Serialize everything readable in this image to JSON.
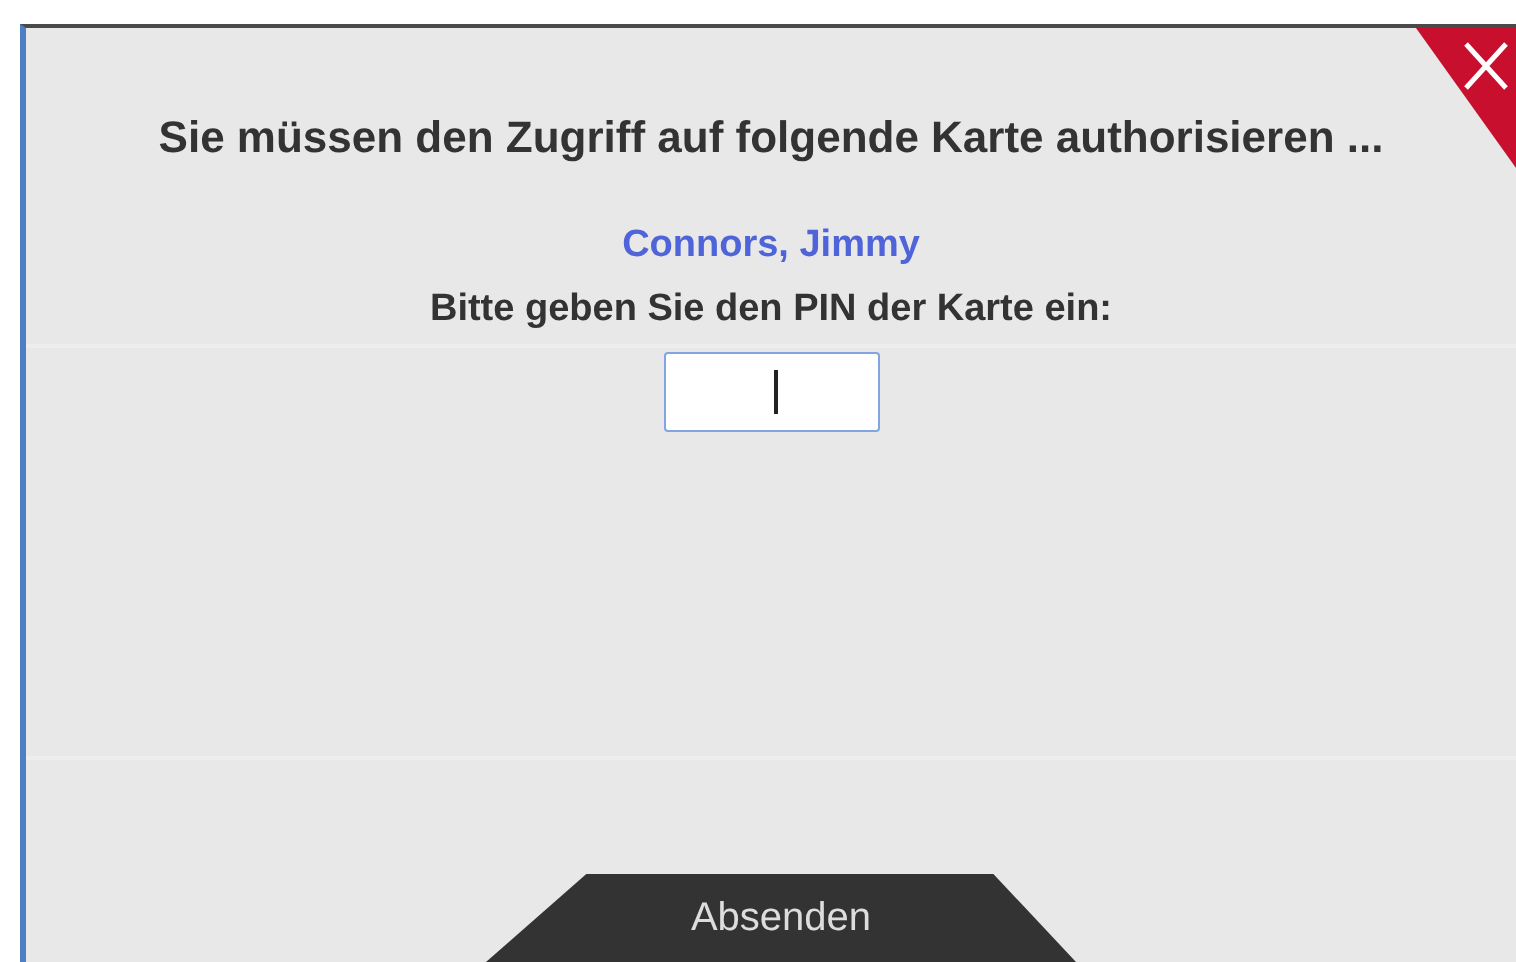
{
  "dialog": {
    "title": "Sie müssen den Zugriff auf folgende Karte authorisieren ...",
    "card_name": "Connors, Jimmy",
    "prompt": "Bitte geben Sie den PIN der Karte ein:",
    "submit": "Absenden"
  }
}
